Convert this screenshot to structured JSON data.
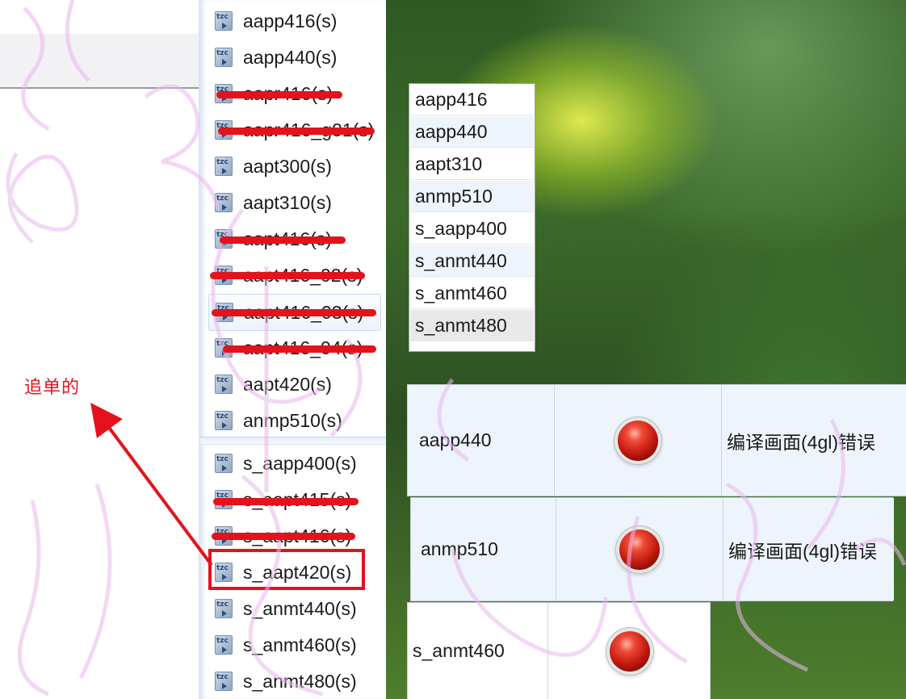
{
  "file_list": {
    "items": [
      {
        "label": "aapp416(s)",
        "struck": false
      },
      {
        "label": "aapp440(s)",
        "struck": false
      },
      {
        "label": "aapr416(s)",
        "struck": true
      },
      {
        "label": "aapr416_g01(s)",
        "struck": true
      },
      {
        "label": "aapt300(s)",
        "struck": false
      },
      {
        "label": "aapt310(s)",
        "struck": false
      },
      {
        "label": "aapt416(s)",
        "struck": true
      },
      {
        "label": "aapt416_02(s)",
        "struck": true
      },
      {
        "label": "aapt416_03(s)",
        "struck": true,
        "selected": true
      },
      {
        "label": "aapt416_04(s)",
        "struck": true
      },
      {
        "label": "aapt420(s)",
        "struck": false
      },
      {
        "label": "anmp510(s)",
        "struck": false
      }
    ],
    "items_lower": [
      {
        "label": "s_aapp400(s)",
        "struck": false
      },
      {
        "label": "s_aapt415(s)",
        "struck": true
      },
      {
        "label": "s_aapt416(s)",
        "struck": true
      },
      {
        "label": "s_aapt420(s)",
        "struck": false,
        "highlighted": true
      },
      {
        "label": "s_anmt440(s)",
        "struck": false
      },
      {
        "label": "s_anmt460(s)",
        "struck": false
      },
      {
        "label": "s_anmt480(s)",
        "struck": false
      }
    ],
    "icon_text": "tzc"
  },
  "popup_list": {
    "items": [
      "aapp416",
      "aapp440",
      "aapt310",
      "anmp510",
      "s_aapp400",
      "s_anmt440",
      "s_anmt460",
      "s_anmt480"
    ]
  },
  "status_rows": [
    {
      "name": "aapp440",
      "status_icon": "red-light-icon",
      "message": "编译画面(4gl)错误"
    },
    {
      "name": "anmp510",
      "status_icon": "red-light-icon",
      "message": "编译画面(4gl)错误"
    },
    {
      "name": "s_anmt460",
      "status_icon": "red-light-icon",
      "message": ""
    }
  ],
  "annotation": {
    "text": "追单的",
    "color": "#e3121b"
  },
  "colors": {
    "strike": "#e3121b",
    "highlight_box": "#e3121b",
    "row_shade": "#eef4fb"
  }
}
